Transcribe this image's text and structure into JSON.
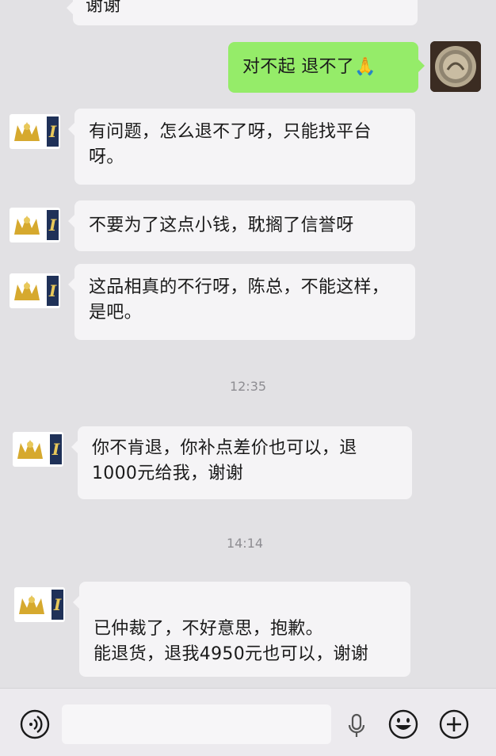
{
  "messages": [
    {
      "side": "in",
      "text": "谢谢"
    },
    {
      "side": "me",
      "text": "对不起 退不了🙏"
    },
    {
      "side": "in",
      "text": "有问题，怎么退不了呀，只能找平台呀。"
    },
    {
      "side": "in",
      "text": "不要为了这点小钱，耽搁了信誉呀"
    },
    {
      "side": "in",
      "text": "这品相真的不行呀，陈总，不能这样，是吧。"
    },
    {
      "side": "in",
      "text": "你不肯退，你补点差价也可以，退1000元给我，谢谢"
    },
    {
      "side": "in",
      "text": "已仲裁了，不好意思，抱歉。\n能退货，退我4950元也可以，谢谢"
    }
  ],
  "times": [
    "12:35",
    "14:14"
  ],
  "avatar_glyph": "I",
  "colors": {
    "background": "#e2e1e4",
    "bubble_in": "#f5f4f6",
    "bubble_me": "#95ec69",
    "timestamp": "#8e8d92"
  },
  "bottom_bar": {
    "icons": [
      "voice-icon",
      "mic-icon",
      "emoji-icon",
      "plus-icon"
    ]
  }
}
